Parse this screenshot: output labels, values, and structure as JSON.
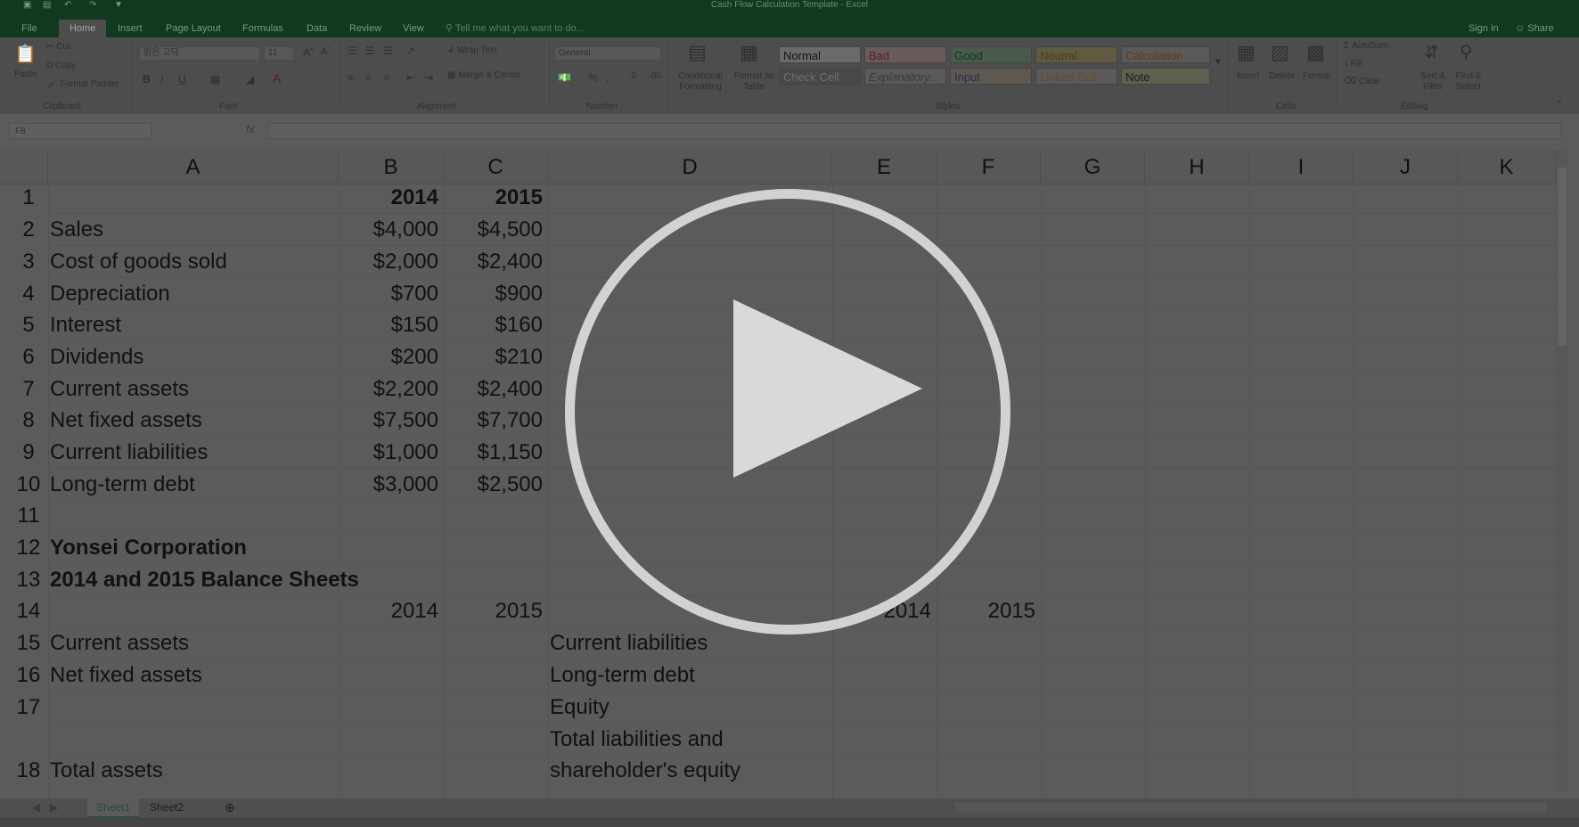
{
  "window": {
    "title": "Cash Flow Calculation Template - Excel"
  },
  "tabs": [
    "File",
    "Home",
    "Insert",
    "Page Layout",
    "Formulas",
    "Data",
    "Review",
    "View"
  ],
  "active_tab": "Home",
  "tell_me": "Tell me what you want to do...",
  "account": {
    "sign_in": "Sign in",
    "share": "Share"
  },
  "ribbon": {
    "clipboard": {
      "paste": "Paste",
      "cut": "Cut",
      "copy": "Copy",
      "format_painter": "Format Painter",
      "group": "Clipboard"
    },
    "font": {
      "name": "맑은 고딕",
      "size": "11",
      "group": "Font"
    },
    "alignment": {
      "wrap": "Wrap Text",
      "merge": "Merge & Center",
      "group": "Alignment"
    },
    "number": {
      "format": "General",
      "group": "Number"
    },
    "styles": {
      "conditional": "Conditional Formatting",
      "format_table": "Format as Table",
      "cells": [
        {
          "label": "Normal",
          "bg": "#6a6a6a",
          "fg": "#161616"
        },
        {
          "label": "Bad",
          "bg": "#6a5a5c",
          "fg": "#5a1e24"
        },
        {
          "label": "Good",
          "bg": "#4a5a4a",
          "fg": "#0f3a1d"
        },
        {
          "label": "Neutral",
          "bg": "#5f5a40",
          "fg": "#4e3c10"
        },
        {
          "label": "Calculation",
          "bg": "#5a5a5a",
          "fg": "#6a3410"
        },
        {
          "label": "Check Cell",
          "bg": "#484848",
          "fg": "#6f6f6f"
        },
        {
          "label": "Explanatory...",
          "bg": "#5a5a5a",
          "fg": "#3a3a3a"
        },
        {
          "label": "Input",
          "bg": "#5f5850",
          "fg": "#2a2a50"
        },
        {
          "label": "Linked Cell",
          "bg": "#5a5a5a",
          "fg": "#6b4a25"
        },
        {
          "label": "Note",
          "bg": "#5f5f50",
          "fg": "#1d1d1d"
        }
      ],
      "group": "Styles"
    },
    "cells": {
      "insert": "Insert",
      "delete": "Delete",
      "format": "Format",
      "group": "Cells"
    },
    "editing": {
      "autosum": "AutoSum",
      "fill": "Fill",
      "clear": "Clear",
      "sort": "Sort & Filter",
      "find": "Find & Select",
      "group": "Editing"
    }
  },
  "name_box": "F8",
  "fx": "fx",
  "columns": [
    "A",
    "B",
    "C",
    "D",
    "E",
    "F",
    "G",
    "H",
    "I",
    "J",
    "K"
  ],
  "rows": [
    {
      "num": "1",
      "a": "",
      "b": "2014",
      "c": "2015",
      "d": "",
      "e": "",
      "f": "",
      "bold": true
    },
    {
      "num": "2",
      "a": "Sales",
      "b": "$4,000",
      "c": "$4,500",
      "d": "",
      "e": "",
      "f": ""
    },
    {
      "num": "3",
      "a": "Cost of goods sold",
      "b": "$2,000",
      "c": "$2,400",
      "d": "",
      "e": "",
      "f": ""
    },
    {
      "num": "4",
      "a": "Depreciation",
      "b": "$700",
      "c": "$900",
      "d": "",
      "e": "",
      "f": ""
    },
    {
      "num": "5",
      "a": "Interest",
      "b": "$150",
      "c": "$160",
      "d": "",
      "e": "",
      "f": ""
    },
    {
      "num": "6",
      "a": "Dividends",
      "b": "$200",
      "c": "$210",
      "d": "",
      "e": "",
      "f": ""
    },
    {
      "num": "7",
      "a": "Current assets",
      "b": "$2,200",
      "c": "$2,400",
      "d": "",
      "e": "",
      "f": ""
    },
    {
      "num": "8",
      "a": "Net fixed assets",
      "b": "$7,500",
      "c": "$7,700",
      "d": "",
      "e": "",
      "f": ""
    },
    {
      "num": "9",
      "a": "Current liabilities",
      "b": "$1,000",
      "c": "$1,150",
      "d": "",
      "e": "",
      "f": ""
    },
    {
      "num": "10",
      "a": "Long-term debt",
      "b": "$3,000",
      "c": "$2,500",
      "d": "",
      "e": "",
      "f": ""
    },
    {
      "num": "11",
      "a": "",
      "b": "",
      "c": "",
      "d": "",
      "e": "",
      "f": ""
    },
    {
      "num": "12",
      "a": "Yonsei Corporation",
      "b": "",
      "c": "",
      "d": "",
      "e": "",
      "f": "",
      "bold": true
    },
    {
      "num": "13",
      "a": "2014 and 2015 Balance Sheets",
      "b": "",
      "c": "",
      "d": "",
      "e": "",
      "f": "",
      "bold": true
    },
    {
      "num": "14",
      "a": "",
      "b": "2014",
      "c": "2015",
      "d": "",
      "e": "2014",
      "f": "2015"
    },
    {
      "num": "15",
      "a": "Current assets",
      "b": "",
      "c": "",
      "d": "Current liabilities",
      "e": "",
      "f": ""
    },
    {
      "num": "16",
      "a": "Net fixed assets",
      "b": "",
      "c": "",
      "d": "Long-term debt",
      "e": "",
      "f": ""
    },
    {
      "num": "17",
      "a": "",
      "b": "",
      "c": "",
      "d": "Equity",
      "e": "",
      "f": ""
    },
    {
      "num": "",
      "a": "",
      "b": "",
      "c": "",
      "d": "Total liabilities and",
      "e": "",
      "f": ""
    },
    {
      "num": "18",
      "a": "Total assets",
      "b": "",
      "c": "",
      "d": "shareholder's equity",
      "e": "",
      "f": ""
    }
  ],
  "sheets": [
    "Sheet1",
    "Sheet2"
  ],
  "active_sheet": "Sheet1",
  "overlay": {
    "icon": "play-icon"
  }
}
